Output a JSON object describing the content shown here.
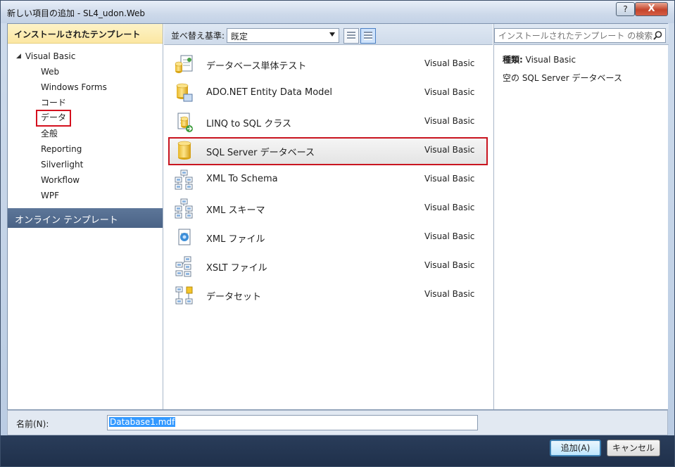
{
  "window": {
    "title": "新しい項目の追加 - SL4_udon.Web",
    "help_label": "?",
    "close_label": "X"
  },
  "left_pane": {
    "installed_header": "インストールされたテンプレート",
    "root_label": "Visual Basic",
    "items": [
      {
        "label": "Web",
        "selected": false
      },
      {
        "label": "Windows Forms",
        "selected": false
      },
      {
        "label": "コード",
        "selected": false
      },
      {
        "label": "データ",
        "selected": true
      },
      {
        "label": "全般",
        "selected": false
      },
      {
        "label": "Reporting",
        "selected": false
      },
      {
        "label": "Silverlight",
        "selected": false
      },
      {
        "label": "Workflow",
        "selected": false
      },
      {
        "label": "WPF",
        "selected": false
      }
    ],
    "online_header": "オンライン テンプレート"
  },
  "sort_bar": {
    "label": "並べ替え基準:",
    "selected": "既定"
  },
  "templates": [
    {
      "name": "データベース単体テスト",
      "lang": "Visual Basic",
      "icon": "database-unit-test-icon",
      "selected": false
    },
    {
      "name": "ADO.NET Entity Data Model",
      "lang": "Visual Basic",
      "icon": "entity-data-model-icon",
      "selected": false
    },
    {
      "name": "LINQ to SQL クラス",
      "lang": "Visual Basic",
      "icon": "linq-to-sql-icon",
      "selected": false
    },
    {
      "name": "SQL Server データベース",
      "lang": "Visual Basic",
      "icon": "sql-database-icon",
      "selected": true
    },
    {
      "name": "XML To Schema",
      "lang": "Visual Basic",
      "icon": "xml-schema-icon",
      "selected": false
    },
    {
      "name": "XML スキーマ",
      "lang": "Visual Basic",
      "icon": "xml-schema-icon",
      "selected": false
    },
    {
      "name": "XML ファイル",
      "lang": "Visual Basic",
      "icon": "xml-file-icon",
      "selected": false
    },
    {
      "name": "XSLT ファイル",
      "lang": "Visual Basic",
      "icon": "xslt-file-icon",
      "selected": false
    },
    {
      "name": "データセット",
      "lang": "Visual Basic",
      "icon": "dataset-icon",
      "selected": false
    }
  ],
  "right_pane": {
    "search_placeholder": "インストールされたテンプレート の検索",
    "type_label": "種類:",
    "type_value": "Visual Basic",
    "description": "空の SQL Server データベース"
  },
  "footer": {
    "name_label": "名前(N):",
    "name_value": "Database1.mdf"
  },
  "buttons": {
    "add": "追加(A)",
    "cancel": "キャンセル"
  }
}
